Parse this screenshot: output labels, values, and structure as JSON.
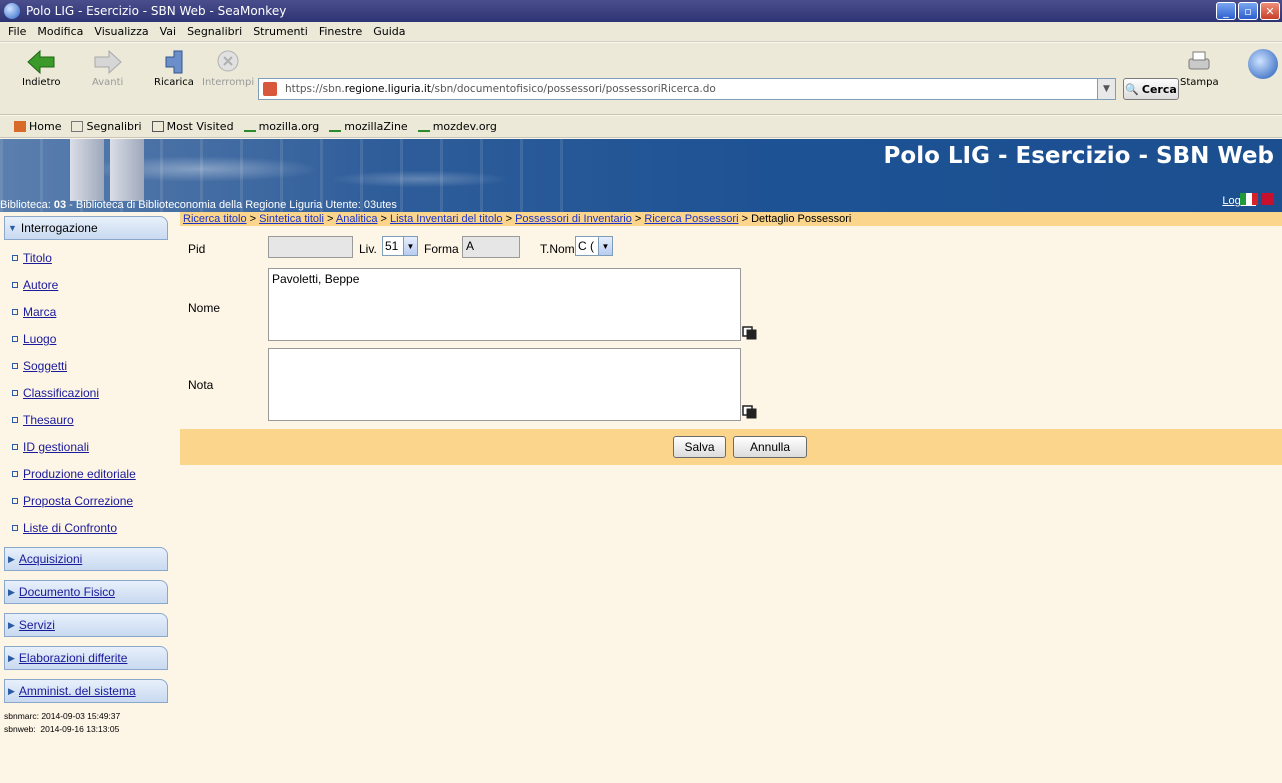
{
  "window": {
    "title": "Polo LIG - Esercizio - SBN Web - SeaMonkey",
    "buttons": [
      "_",
      "▫",
      "✕"
    ]
  },
  "menu": [
    "File",
    "Modifica",
    "Visualizza",
    "Vai",
    "Segnalibri",
    "Strumenti",
    "Finestre",
    "Guida"
  ],
  "nav": {
    "back": "Indietro",
    "forward": "Avanti",
    "reload": "Ricarica",
    "stop": "Interrompi",
    "print": "Stampa",
    "url_prefix": "https://sbn.",
    "url_host": "regione.liguria.it",
    "url_path": "/sbn/documentofisico/possessori/possessoriRicerca.do",
    "search_button": "Cerca"
  },
  "bookmarks": [
    "Home",
    "Segnalibri",
    "Most Visited",
    "mozilla.org",
    "mozillaZine",
    "mozdev.org"
  ],
  "banner": {
    "app_title": "Polo LIG - Esercizio - SBN Web",
    "biblioteca_label": "Biblioteca:",
    "biblioteca_code": "03",
    "biblioteca_name": "- Biblioteca di Biblioteconomia della Regione Liguria",
    "utente": "Utente: 03utes",
    "logout": "Logout"
  },
  "breadcrumb": {
    "links": [
      "Ricerca titolo",
      "Sintetica titoli",
      "Analitica",
      "Lista Inventari del titolo",
      "Possessori di Inventario",
      "Ricerca Possessori"
    ],
    "current": "Dettaglio Possessori",
    "separator": " > "
  },
  "sidebar": {
    "open_section": "Interrogazione",
    "items": [
      "Titolo",
      "Autore",
      "Marca",
      "Luogo",
      "Soggetti",
      "Classificazioni",
      "Thesauro",
      "ID gestionali",
      "Produzione editoriale",
      "Proposta Correzione",
      "Liste di Confronto"
    ],
    "sections": [
      "Acquisizioni",
      "Documento Fisico",
      "Servizi",
      "Elaborazioni differite",
      "Amminist. del sistema"
    ],
    "timestamps": [
      "sbnmarc: 2014-09-03 15:49:37",
      "sbnweb:  2014-09-16 13:13:05"
    ]
  },
  "form": {
    "pid_label": "Pid",
    "pid_value": "",
    "liv_label": "Liv.",
    "liv_value": "51",
    "forma_label": "Forma",
    "forma_value": "A",
    "tnome_label": "T.Nome",
    "tnome_value": "C (",
    "nome_label": "Nome",
    "nome_value": "Pavoletti, Beppe",
    "nota_label": "Nota",
    "nota_value": ""
  },
  "actions": {
    "save": "Salva",
    "cancel": "Annulla"
  },
  "colors": {
    "page_bg": "#fdf5e6",
    "action_bar": "#fbd58c",
    "banner": "#1d5294",
    "link": "#1a33c8"
  }
}
